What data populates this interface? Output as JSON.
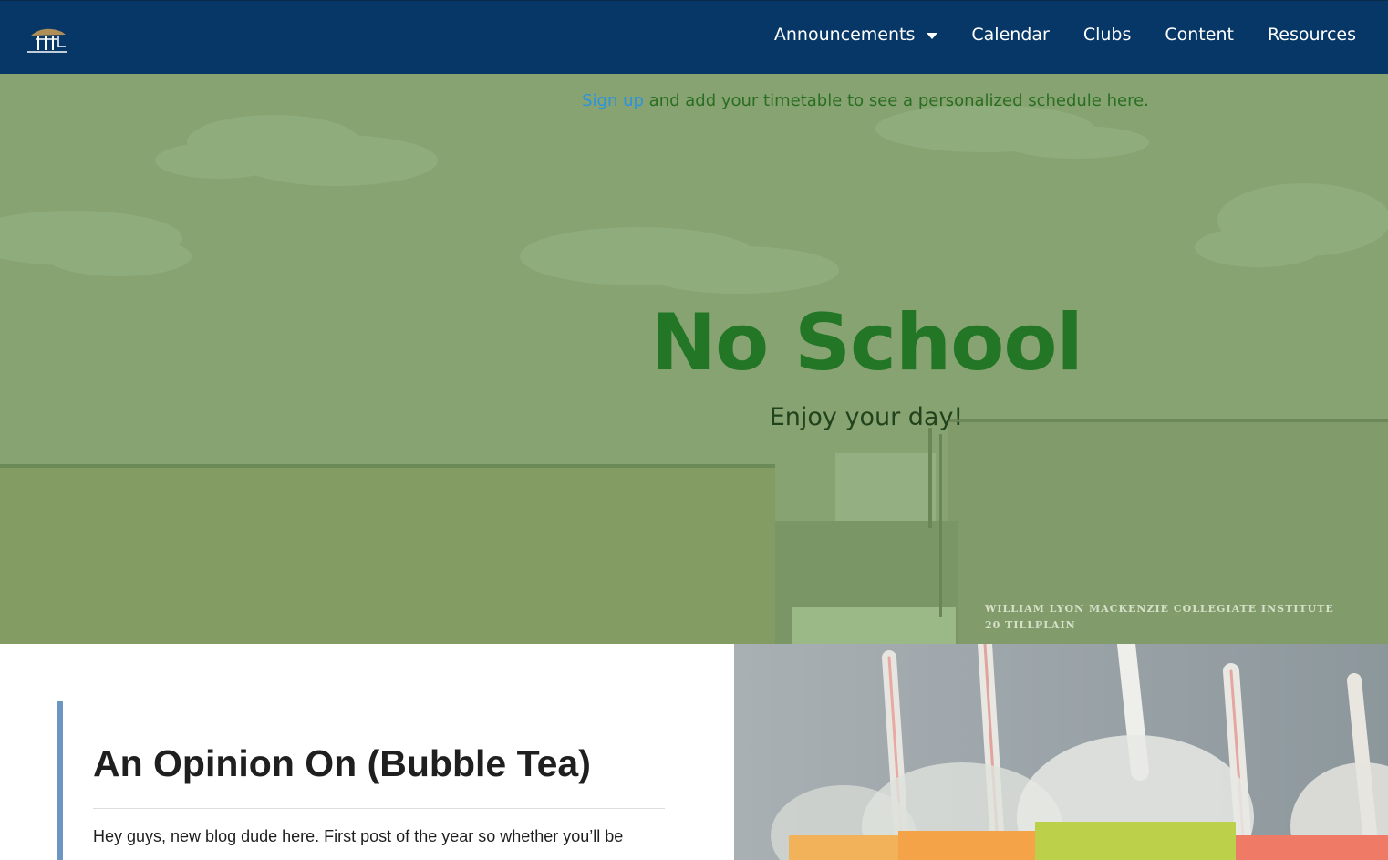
{
  "nav": {
    "logo": "school-logo",
    "items": [
      {
        "label": "Announcements",
        "has_dropdown": true
      },
      {
        "label": "Calendar"
      },
      {
        "label": "Clubs"
      },
      {
        "label": "Content"
      },
      {
        "label": "Resources"
      }
    ]
  },
  "hero": {
    "signup_link": "Sign up",
    "signup_text": " and add your timetable to see a personalized schedule here.",
    "title": "No School",
    "subtitle": "Enjoy your day!",
    "sign_line1": "WILLIAM LYON MACKENZIE COLLEGIATE INSTITUTE",
    "sign_line2": "20 TILLPLAIN"
  },
  "article": {
    "title": "An Opinion On (Bubble Tea)",
    "excerpt": "Hey guys, new blog dude here. First post of the year so whether you’ll be"
  },
  "colors": {
    "nav_bg": "#063767",
    "hero_overlay": "#86a371",
    "hero_title": "#237626",
    "link": "#2b93e0",
    "accent_bar": "#6e96c2"
  }
}
